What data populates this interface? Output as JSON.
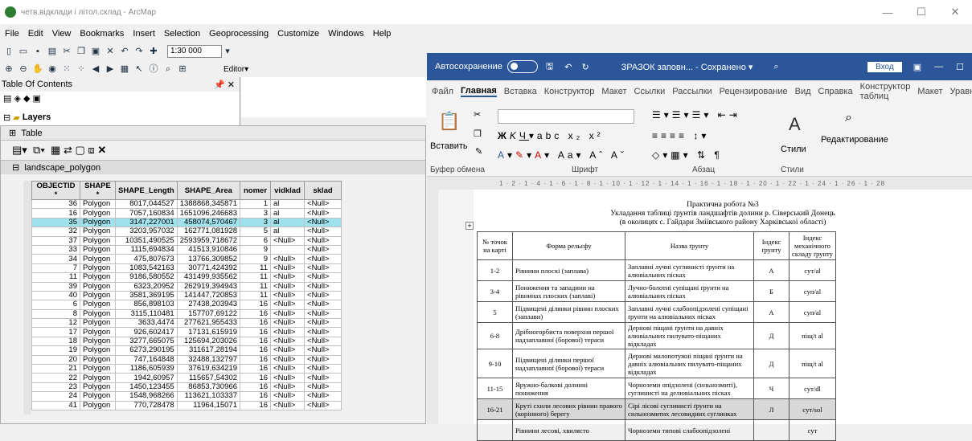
{
  "window": {
    "title": "четв.відклади і літол.склад - ArcMap",
    "min": "—",
    "max": "☐",
    "close": "✕"
  },
  "menu": [
    "File",
    "Edit",
    "View",
    "Bookmarks",
    "Insert",
    "Selection",
    "Geoprocessing",
    "Customize",
    "Windows",
    "Help"
  ],
  "toolbar": {
    "scale": "1:30 000",
    "editor": "Editor▾"
  },
  "toc": {
    "title": "Table Of Contents",
    "pin": "📌 ✕",
    "layers": "Layers"
  },
  "table": {
    "title": "Table",
    "layer": "landscape_polygon",
    "columns": [
      "OBJECTID *",
      "SHAPE *",
      "SHAPE_Length",
      "SHAPE_Area",
      "nomer",
      "vidklad",
      "sklad"
    ],
    "rows": [
      [
        "36",
        "Polygon",
        "8017,044527",
        "1388868,345871",
        "1",
        "al",
        "<Null>"
      ],
      [
        "16",
        "Polygon",
        "7057,160834",
        "1651096,246683",
        "3",
        "al",
        "<Null>"
      ],
      [
        "35",
        "Polygon",
        "3147,227001",
        "458074,570467",
        "3",
        "al",
        "<Null>"
      ],
      [
        "32",
        "Polygon",
        "3203,957032",
        "162771,081928",
        "5",
        "al",
        "<Null>"
      ],
      [
        "37",
        "Polygon",
        "10351,490525",
        "2593959,718672",
        "6",
        "<Null>",
        "<Null>"
      ],
      [
        "33",
        "Polygon",
        "1115,694834",
        "41513,910846",
        "9",
        "",
        "<Null>"
      ],
      [
        "34",
        "Polygon",
        "475,807673",
        "13766,309852",
        "9",
        "<Null>",
        "<Null>"
      ],
      [
        "7",
        "Polygon",
        "1083,542163",
        "30771,424392",
        "11",
        "<Null>",
        "<Null>"
      ],
      [
        "11",
        "Polygon",
        "9186,580552",
        "431499,935562",
        "11",
        "<Null>",
        "<Null>"
      ],
      [
        "39",
        "Polygon",
        "6323,20952",
        "262919,394943",
        "11",
        "<Null>",
        "<Null>"
      ],
      [
        "40",
        "Polygon",
        "3581,369195",
        "141447,720853",
        "11",
        "<Null>",
        "<Null>"
      ],
      [
        "6",
        "Polygon",
        "856,898103",
        "27438,203943",
        "16",
        "<Null>",
        "<Null>"
      ],
      [
        "8",
        "Polygon",
        "3115,110481",
        "157707,69122",
        "16",
        "<Null>",
        "<Null>"
      ],
      [
        "12",
        "Polygon",
        "3633,4474",
        "277621,955433",
        "16",
        "<Null>",
        "<Null>"
      ],
      [
        "17",
        "Polygon",
        "926,602417",
        "17131,615919",
        "16",
        "<Null>",
        "<Null>"
      ],
      [
        "18",
        "Polygon",
        "3277,665075",
        "125694,203026",
        "16",
        "<Null>",
        "<Null>"
      ],
      [
        "19",
        "Polygon",
        "6273,290195",
        "311617,28194",
        "16",
        "<Null>",
        "<Null>"
      ],
      [
        "20",
        "Polygon",
        "747,164848",
        "32488,132797",
        "16",
        "<Null>",
        "<Null>"
      ],
      [
        "21",
        "Polygon",
        "1186,605939",
        "37619,634219",
        "16",
        "<Null>",
        "<Null>"
      ],
      [
        "22",
        "Polygon",
        "1942,60957",
        "115657,54302",
        "16",
        "<Null>",
        "<Null>"
      ],
      [
        "23",
        "Polygon",
        "1450,123455",
        "86853,730966",
        "16",
        "<Null>",
        "<Null>"
      ],
      [
        "24",
        "Polygon",
        "1548,968266",
        "113621,103337",
        "16",
        "<Null>",
        "<Null>"
      ],
      [
        "41",
        "Polygon",
        "770,728478",
        "11964,15071",
        "16",
        "<Null>",
        "<Null>"
      ]
    ]
  },
  "word": {
    "autosave": "Автосохранение",
    "doctitle": "ЗРАЗОК заповн... - Сохранено ▾",
    "login": "Вход",
    "tabs": [
      "Файл",
      "Главная",
      "Вставка",
      "Конструктор",
      "Макет",
      "Ссылки",
      "Рассылки",
      "Рецензирование",
      "Вид",
      "Справка",
      "Конструктор таблиц",
      "Макет",
      "Уравнение"
    ],
    "groups": {
      "clipboard": "Буфер обмена",
      "font": "Шрифт",
      "paragraph": "Абзац",
      "styles": "Стили",
      "styles_btn": "Стили",
      "editing": "Редактирование",
      "paste": "Вставить"
    },
    "ruler": "1 · 2 · 1 · 4 · 1 · 6 · 1 · 8 · 1 · 10 · 1 · 12 · 1 · 14 · 1 · 16 · 1 · 18 · 1 · 20 · 1 · 22 · 1 · 24 · 1 · 26 · 1 · 28",
    "doc_title": [
      "Практична робота №3",
      "Укладання таблиці ґрунтів ландшафтів долини р. Сіверський Донець",
      "(в околицях с. Гайдари Зміївського району Харківської області)"
    ],
    "headers": [
      "№ точок на карті",
      "Форма рельєфу",
      "Назва ґрунту",
      "Індекс ґрунту",
      "Індекс механічного складу ґрунту"
    ],
    "rows": [
      [
        "1-2",
        "Рівнини плоскі (заплава)",
        "Заплавні лучні суглинисті ґрунти на алювіальних пісках",
        "A",
        "сут/аl"
      ],
      [
        "3-4",
        "Пониження та западини на рівнинах плоских (заплаві)",
        "Лучно-болотні супіщані ґрунти на алювіальних пісках",
        "Б",
        "суп/аl"
      ],
      [
        "5",
        "Підвищені ділянки рівнин плоских (заплави)",
        "Заплавні лучні слабоопідзолені супіщані ґрунти на алювіальних пісках",
        "А",
        "суп/аl"
      ],
      [
        "6-8",
        "Дрібногорбиста поверхня першої надзаплавної (борової) тераси",
        "Дернові піщані ґрунти на давніх алювіальних пилувато-піщаних відкладах",
        "Д",
        "піщ/t аl"
      ],
      [
        "9-10",
        "Підвищені ділянки першої надзаплавної (борової) тераси",
        "Дернові малопотужні піщані ґрунти на давніх алювіальних пилувато-піщаних відкладах",
        "Д",
        "піщ/t аl"
      ],
      [
        "11-15",
        "Яружно-балкові долинні пониження",
        "Чорноземи опідзолені (сильнозмиті), суглинисті на делювіальних пісках",
        "Ч",
        "сут/dl"
      ],
      [
        "16-21",
        "Круті схили лесових рівнин правого (корінного) берегу",
        "Сірі лісові суглинисті ґрунти на сильнозмитих лесовидних суглинках",
        "Л",
        "сут/sol"
      ],
      [
        "",
        "Рівнини лесові, хвилясто",
        "Чорноземи типові слабоопідзолені",
        "",
        "сут"
      ]
    ]
  }
}
